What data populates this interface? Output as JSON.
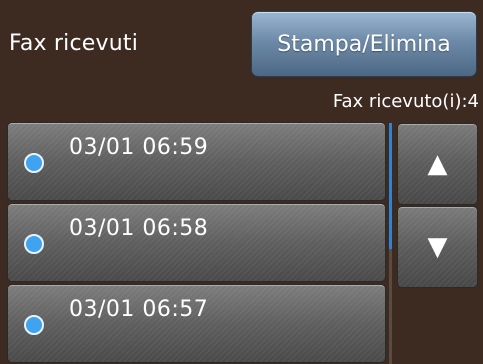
{
  "header": {
    "title": "Fax ricevuti",
    "action_label": "Stampa/Elimina"
  },
  "status": {
    "count_text": "Fax ricevuto(i):4"
  },
  "list": {
    "items": [
      {
        "label": "03/01 06:59"
      },
      {
        "label": "03/01 06:58"
      },
      {
        "label": "03/01 06:57"
      }
    ]
  },
  "nav": {
    "up_glyph": "▲",
    "down_glyph": "▼",
    "up_icon": "arrow-up-icon",
    "down_icon": "arrow-down-icon"
  },
  "colors": {
    "background": "#3d2b22",
    "accent_blue": "#3fa3f0",
    "button_blue": "#6d8aa8",
    "scroll_blue": "#2f83d6"
  }
}
